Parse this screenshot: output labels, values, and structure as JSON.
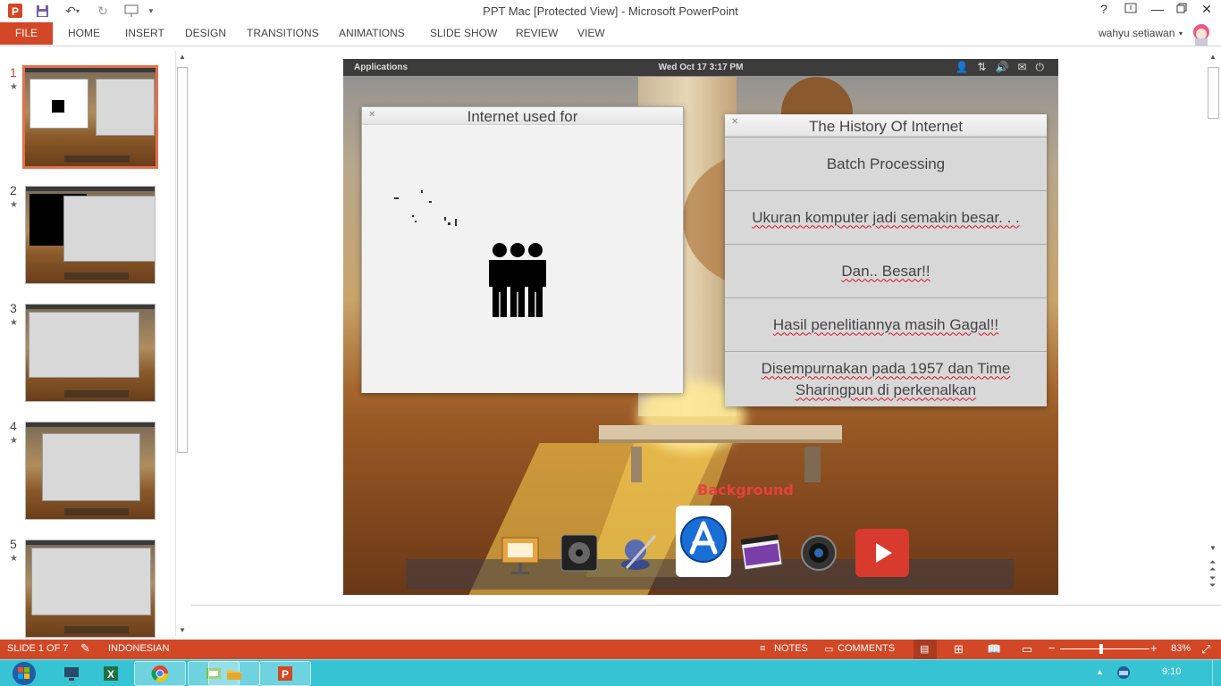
{
  "window": {
    "title": "PPT Mac [Protected View] - Microsoft PowerPoint",
    "user": "wahyu setiawan",
    "help": "?"
  },
  "ribbon": {
    "tabs": [
      "FILE",
      "HOME",
      "INSERT",
      "DESIGN",
      "TRANSITIONS",
      "ANIMATIONS",
      "SLIDE SHOW",
      "REVIEW",
      "VIEW"
    ]
  },
  "thumbnails": {
    "numbers": [
      "1",
      "2",
      "3",
      "4",
      "5"
    ],
    "star": "★"
  },
  "slide": {
    "topbar": {
      "apps": "Applications",
      "clock": "Wed Oct 17  3:17 PM"
    },
    "window_left_title": "Internet used for",
    "window_right_title": "The History Of Internet",
    "items": [
      "Batch Processing",
      "Ukuran komputer jadi semakin besar. . .",
      "Dan.. Besar!!",
      "Hasil penelitiannya masih Gagal!!",
      "Disempurnakan pada 1957 dan Time Sharingpun di perkenalkan"
    ],
    "dock_label": "Background"
  },
  "status": {
    "slide": "SLIDE 1 OF 7",
    "language": "INDONESIAN",
    "notes": "NOTES",
    "comments": "COMMENTS",
    "zoom": "83%",
    "zoom_fraction": 0.46
  },
  "taskbar": {
    "time": "9:10"
  },
  "colors": {
    "accent": "#d24726",
    "taskbar": "#36c3d3"
  }
}
